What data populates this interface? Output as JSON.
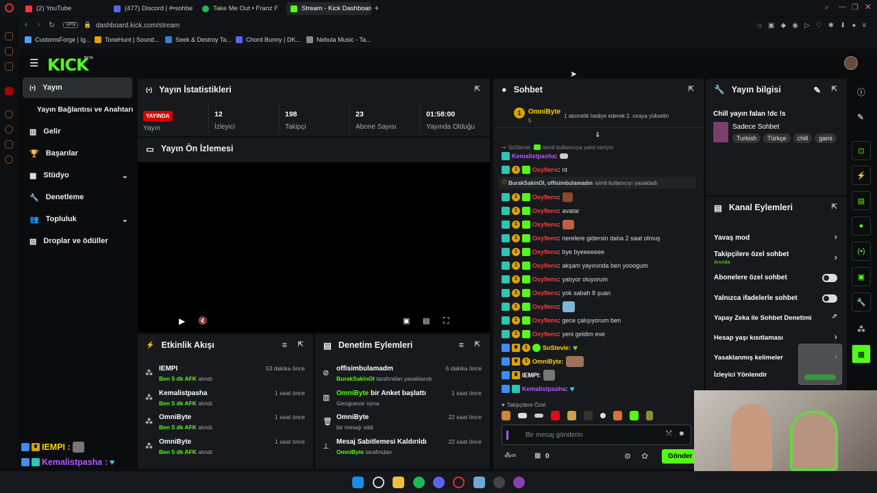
{
  "browser": {
    "tabs": [
      {
        "label": "(2) YouTube",
        "color": "#ff3333"
      },
      {
        "label": "(477) Discord | #•sohbe",
        "color": "#5865f2"
      },
      {
        "label": "Take Me Out • Franz F",
        "color": "#1db954"
      },
      {
        "label": "Stream - Kick Dashboard",
        "color": "#53fc18",
        "active": true
      }
    ],
    "new_tab": "+",
    "vpn": "VPN",
    "url": "dashboard.kick.com/stream",
    "bookmarks": [
      "CustomsForge | Ig...",
      "ToneHunt | Sound...",
      "Seek & Destroy Ta...",
      "Chord Bunny | DK...",
      "Nebula Music - Ta..."
    ]
  },
  "app": {
    "logo": "KICK",
    "beta": "BETA",
    "accent": "#53fc18"
  },
  "nav": {
    "items": [
      {
        "label": "Yayın",
        "icon": "broadcast-icon",
        "active": true
      },
      {
        "label": "Yayın Bağlantısı ve Anahtarı",
        "icon": ""
      },
      {
        "label": "Gelir",
        "icon": "chart-icon"
      },
      {
        "label": "Başarılar",
        "icon": "trophy-icon"
      },
      {
        "label": "Stüdyo",
        "icon": "studio-icon",
        "chevron": true
      },
      {
        "label": "Denetleme",
        "icon": "wrench-icon"
      },
      {
        "label": "Topluluk",
        "icon": "users-icon",
        "chevron": true
      },
      {
        "label": "Droplar ve ödüller",
        "icon": "gift-icon"
      }
    ]
  },
  "stats": {
    "title": "Yayın İstatistikleri",
    "live_badge": "YAYINDA",
    "items": [
      {
        "value": "",
        "label": "Yayın"
      },
      {
        "value": "12",
        "label": "İzleyici"
      },
      {
        "value": "198",
        "label": "Takipçi"
      },
      {
        "value": "23",
        "label": "Abone Sayısı"
      },
      {
        "value": "01:58:00",
        "label": "Yayında Olduğu"
      }
    ]
  },
  "preview": {
    "title": "Yayın Ön İzlemesi"
  },
  "activity": {
    "title": "Etkinlik Akışı",
    "rows": [
      {
        "name": "IEMPI",
        "sub_bold": "Ben 5 dk AFK",
        "sub": "alındı",
        "time": "53 dakika önce"
      },
      {
        "name": "Kemalistpasha",
        "sub_bold": "Ben 5 dk AFK",
        "sub": "alındı",
        "time": "1 saat önce"
      },
      {
        "name": "OmniByte",
        "sub_bold": "Ben 5 dk AFK",
        "sub": "alındı",
        "time": "1 saat önce"
      },
      {
        "name": "OmniByte",
        "sub_bold": "Ben 5 dk AFK",
        "sub": "alındı",
        "time": "1 saat önce"
      }
    ]
  },
  "moderation": {
    "title": "Denetim Eylemleri",
    "rows": [
      {
        "name": "offisimbulamadm",
        "sub_bold": "BurakSakinOl",
        "sub": "tarafından yasaklandı",
        "time": "6 dakika önce"
      },
      {
        "name_bold": "OmniByte",
        "name": "bir Anket başlattı",
        "sub": "Geoguessr oyna",
        "time": "1 saat önce"
      },
      {
        "name": "OmniByte",
        "sub": "bir mesajı sildi",
        "time": "22 saat önce"
      },
      {
        "name": "Mesaj Sabitlemesi Kaldırıldı",
        "sub_bold": "OmniByte",
        "sub": "tarafından",
        "time": "22 saat önce"
      }
    ]
  },
  "chat": {
    "title": "Sohbet",
    "pinned_user": "OmniByte",
    "pinned_count": "5",
    "pinned_text": "1 abonelik hediye ederek 2. sıraya yükselin",
    "reply_hint_user": "SoStevie:",
    "reply_hint": "isimli kullanıcıya yanıt veriyor",
    "ban_notice_users": "BurakSakinOl, offisimbulamadm",
    "ban_notice": "isimli kullanıcıyı yasakladı",
    "messages": [
      {
        "user": "Kemalistpasha",
        "color": "#b05cff",
        "text": ""
      },
      {
        "user": "Oxy9ens",
        "color": "#ff3b3b",
        "text": "nt"
      },
      {
        "user": "Oxy9ens",
        "color": "#ff3b3b",
        "text": ""
      },
      {
        "user": "Oxy9ens",
        "color": "#ff3b3b",
        "text": "avatar"
      },
      {
        "user": "Oxy9ens",
        "color": "#ff3b3b",
        "text": ""
      },
      {
        "user": "Oxy9ens",
        "color": "#ff3b3b",
        "text": "nerelere gidersin daha 2 saat olmuş"
      },
      {
        "user": "Oxy9ens",
        "color": "#ff3b3b",
        "text": "bye byeeeeeee"
      },
      {
        "user": "Oxy9ens",
        "color": "#ff3b3b",
        "text": "akşam yayınında ben yooogum"
      },
      {
        "user": "Oxy9ens",
        "color": "#ff3b3b",
        "text": "yatıyor oluyorum"
      },
      {
        "user": "Oxy9ens",
        "color": "#ff3b3b",
        "text": "yok sabah 8 şuan"
      },
      {
        "user": "Oxy9ens",
        "color": "#ff3b3b",
        "text": ""
      },
      {
        "user": "Oxy9ens",
        "color": "#ff3b3b",
        "text": "gece çalışıyorum ben"
      },
      {
        "user": "Oxy9ens",
        "color": "#ff3b3b",
        "text": "yeni geldim eve"
      },
      {
        "user": "SoStevie",
        "color": "#ffd400",
        "text": ""
      },
      {
        "user": "OmniByte",
        "color": "#ffd400",
        "text": ""
      },
      {
        "user": "IEMPI",
        "color": "#ffffff",
        "text": ""
      },
      {
        "user": "Kemalistpasha",
        "color": "#b05cff",
        "text": ""
      }
    ],
    "followers_only": "Takipçilere Özel",
    "input_placeholder": "Bir mesaj gönderin",
    "points": "0",
    "send": "Gönder"
  },
  "stream_info": {
    "title": "Yayın bilgisi",
    "stream_title": "Chill yayın falan !dc !s",
    "category": "Sadece Sohbet",
    "tags": [
      "Turkish",
      "Türkçe",
      "chill",
      "gami"
    ]
  },
  "channel_actions": {
    "title": "Kanal Eylemleri",
    "items": [
      {
        "label": "Yavaş mod",
        "control": "chevron"
      },
      {
        "label": "Takipçilere özel sohbet",
        "sub": "Anında",
        "control": "chevron"
      },
      {
        "label": "Abonelere özel sohbet",
        "control": "toggle"
      },
      {
        "label": "Yalnızca ifadelerle sohbet",
        "control": "toggle"
      },
      {
        "label": "Yapay Zeka ile Sohbet Denetimi",
        "control": "link"
      },
      {
        "label": "Hesap yaşı kısıtlaması",
        "control": "chevron"
      },
      {
        "label": "Yasaklanmış kelimeler",
        "control": "chevron"
      },
      {
        "label": "İzleyici Yönlendir",
        "control": ""
      }
    ]
  },
  "overlay_chat": [
    {
      "user": "IEMPI :",
      "color": "#ffd400"
    },
    {
      "user": "Kemalistpasha :",
      "color": "#b05cff"
    }
  ]
}
